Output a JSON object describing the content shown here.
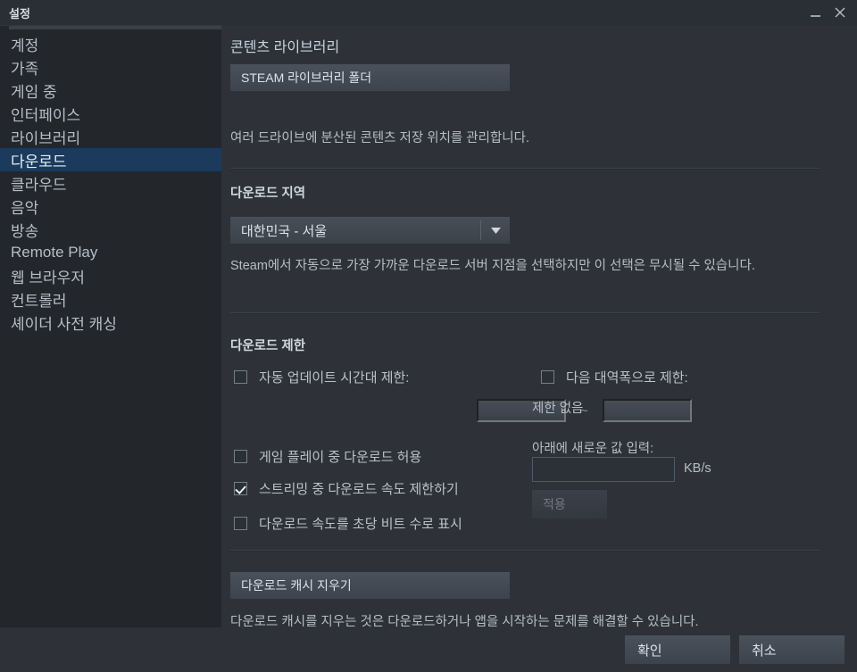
{
  "window": {
    "title": "설정",
    "minimize_icon": "minimize-icon",
    "close_icon": "close-icon"
  },
  "sidebar": {
    "items": [
      {
        "label": "계정",
        "selected": false
      },
      {
        "label": "가족",
        "selected": false
      },
      {
        "label": "게임 중",
        "selected": false
      },
      {
        "label": "인터페이스",
        "selected": false
      },
      {
        "label": "라이브러리",
        "selected": false
      },
      {
        "label": "다운로드",
        "selected": true
      },
      {
        "label": "클라우드",
        "selected": false
      },
      {
        "label": "음악",
        "selected": false
      },
      {
        "label": "방송",
        "selected": false
      },
      {
        "label": "Remote Play",
        "selected": false
      },
      {
        "label": "웹 브라우저",
        "selected": false
      },
      {
        "label": "컨트롤러",
        "selected": false
      },
      {
        "label": "셰이더 사전 캐싱",
        "selected": false
      }
    ]
  },
  "content_library": {
    "title": "콘텐츠 라이브러리",
    "button_label": "STEAM 라이브러리 폴더",
    "description": "여러 드라이브에 분산된 콘텐츠 저장 위치를 관리합니다."
  },
  "download_region": {
    "title": "다운로드 지역",
    "selected_value": "대한민국 - 서울",
    "arrow_icon": "chevron-down-icon",
    "description": "Steam에서 자동으로 가장 가까운 다운로드 서버 지점을 선택하지만 이 선택은 무시될 수 있습니다."
  },
  "download_restrictions": {
    "title": "다운로드 제한",
    "auto_update_window": {
      "label": "자동 업데이트 시간대 제한:",
      "checked": false,
      "start_value": "",
      "end_value": "",
      "separator": "~"
    },
    "checkboxes": [
      {
        "label": "게임 플레이 중 다운로드 허용",
        "checked": false
      },
      {
        "label": "스트리밍 중 다운로드 속도 제한하기",
        "checked": true
      },
      {
        "label": "다운로드 속도를 초당 비트 수로 표시",
        "checked": false
      }
    ],
    "bandwidth": {
      "label": "다음 대역폭으로 제한:",
      "checked": false,
      "current_status": "제한 없음",
      "input_prompt": "아래에 새로운 값 입력:",
      "input_value": "",
      "unit": "KB/s",
      "apply_label": "적용",
      "apply_disabled": true
    }
  },
  "download_cache": {
    "button_label": "다운로드 캐시 지우기",
    "description": "다운로드 캐시를 지우는 것은 다운로드하거나 앱을 시작하는 문제를 해결할 수 있습니다."
  },
  "footer": {
    "ok_label": "확인",
    "cancel_label": "취소"
  },
  "colors": {
    "window_bg": "#2e3238",
    "sidebar_bg": "#23262b",
    "selected_highlight": "#1b3a5c",
    "text": "#b9c1ca",
    "title_text": "#cfd7e0"
  }
}
